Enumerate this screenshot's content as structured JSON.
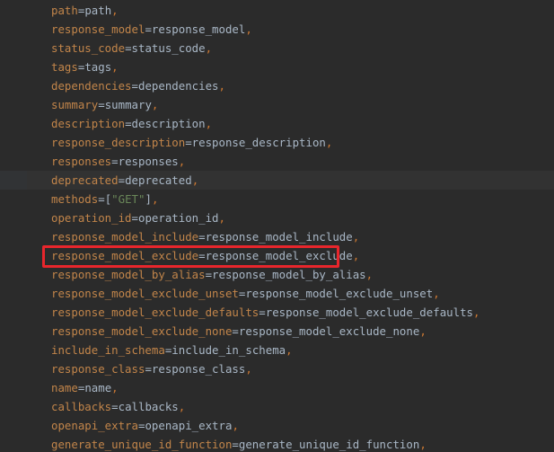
{
  "lines": [
    {
      "param": "path",
      "value": "path",
      "end": ","
    },
    {
      "param": "response_model",
      "value": "response_model",
      "end": ","
    },
    {
      "param": "status_code",
      "value": "status_code",
      "end": ","
    },
    {
      "param": "tags",
      "value": "tags",
      "end": ","
    },
    {
      "param": "dependencies",
      "value": "dependencies",
      "end": ","
    },
    {
      "param": "summary",
      "value": "summary",
      "end": ","
    },
    {
      "param": "description",
      "value": "description",
      "end": ","
    },
    {
      "param": "response_description",
      "value": "response_description",
      "end": ","
    },
    {
      "param": "responses",
      "value": "responses",
      "end": ","
    },
    {
      "param": "deprecated",
      "value": "deprecated",
      "end": ","
    },
    {
      "param": "methods",
      "value": "[\"GET\"]",
      "end": ","
    },
    {
      "param": "operation_id",
      "value": "operation_id",
      "end": ","
    },
    {
      "param": "response_model_include",
      "value": "response_model_include",
      "end": ","
    },
    {
      "param": "response_model_exclude",
      "value": "response_model_exclude",
      "end": ","
    },
    {
      "param": "response_model_by_alias",
      "value": "response_model_by_alias",
      "end": ","
    },
    {
      "param": "response_model_exclude_unset",
      "value": "response_model_exclude_unset",
      "end": ","
    },
    {
      "param": "response_model_exclude_defaults",
      "value": "response_model_exclude_defaults",
      "end": ","
    },
    {
      "param": "response_model_exclude_none",
      "value": "response_model_exclude_none",
      "end": ","
    },
    {
      "param": "include_in_schema",
      "value": "include_in_schema",
      "end": ","
    },
    {
      "param": "response_class",
      "value": "response_class",
      "end": ","
    },
    {
      "param": "name",
      "value": "name",
      "end": ","
    },
    {
      "param": "callbacks",
      "value": "callbacks",
      "end": ","
    },
    {
      "param": "openapi_extra",
      "value": "openapi_extra",
      "end": ","
    },
    {
      "param": "generate_unique_id_function",
      "value": "generate_unique_id_function",
      "end": ","
    }
  ],
  "current_line_index": 9,
  "highlighted_line_index": 13,
  "colors": {
    "background": "#2b2b2b",
    "parameter": "#c2854a",
    "operator": "#a9b7c6",
    "string": "#6a8759",
    "punctuation": "#cc7832",
    "highlight_box": "#e8262c"
  }
}
